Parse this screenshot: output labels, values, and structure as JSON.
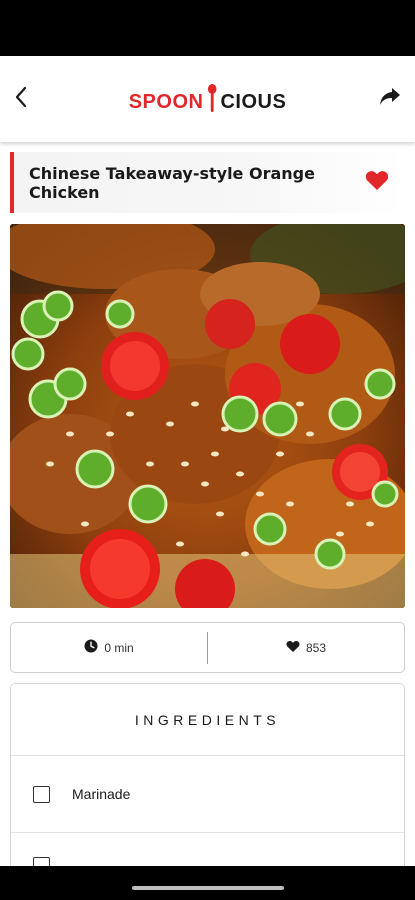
{
  "header": {
    "logo_part1": "SPOON",
    "logo_part2": "CIOUS",
    "back_icon": "chevron-left-icon",
    "share_icon": "share-arrow-icon",
    "brand_color": "#e2272b"
  },
  "recipe": {
    "title": "Chinese Takeaway-style Orange Chicken",
    "favorite_icon": "heart-icon",
    "favorited": true,
    "image_alt": "Orange chicken with sesame, green onions and red chili"
  },
  "stats": {
    "time_label": "0 min",
    "time_icon": "clock-icon",
    "likes_label": "853",
    "likes_icon": "heart-icon"
  },
  "ingredients": {
    "heading": "INGREDIENTS",
    "items": [
      {
        "label": "Marinade",
        "checked": false
      },
      {
        "label": "",
        "checked": false
      }
    ]
  }
}
